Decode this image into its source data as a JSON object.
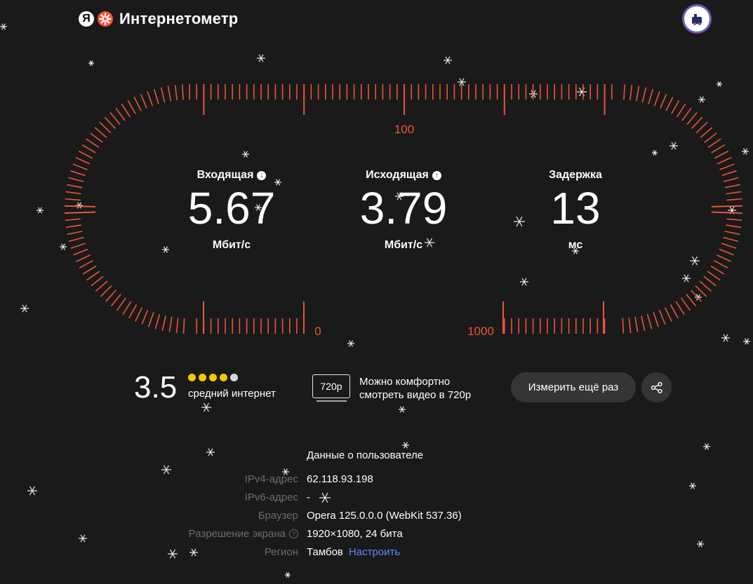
{
  "header": {
    "logo_letter": "Я",
    "title": "Интернетометр",
    "avatar_icon": "user-avatar-icon"
  },
  "gauge": {
    "labels": {
      "top": "100",
      "left": "0",
      "right": "1000"
    },
    "accent": "#e8553a"
  },
  "metrics": {
    "download": {
      "title": "Входящая",
      "value": "5.67",
      "unit": "Мбит/с",
      "icon": "arrow-down-icon"
    },
    "upload": {
      "title": "Исходящая",
      "value": "3.79",
      "unit": "Мбит/с",
      "icon": "arrow-up-icon"
    },
    "latency": {
      "title": "Задержка",
      "value": "13",
      "unit": "мс"
    }
  },
  "score": {
    "value": "3.5",
    "filled_dots": 4,
    "total_dots": 5,
    "dot_color": "#f5c800",
    "label": "средний интернет"
  },
  "video": {
    "quality": "720p",
    "text_line1": "Можно комфортно",
    "text_line2": "смотреть видео в 720p"
  },
  "actions": {
    "retest_label": "Измерить ещё раз",
    "share_icon": "share-icon"
  },
  "user_info": {
    "header": "Данные о пользователе",
    "rows": [
      {
        "label": "IPv4-адрес",
        "value": "62.118.93.198"
      },
      {
        "label": "IPv6-адрес",
        "value": "-"
      },
      {
        "label": "Браузер",
        "value": "Opera 125.0.0.0 (WebKit 537.36)"
      },
      {
        "label": "Разрешение экрана",
        "value": "1920×1080, 24 бита"
      },
      {
        "label": "Регион",
        "value": "Тамбов",
        "link": "Настроить"
      }
    ],
    "link_color": "#5b8cf6"
  }
}
